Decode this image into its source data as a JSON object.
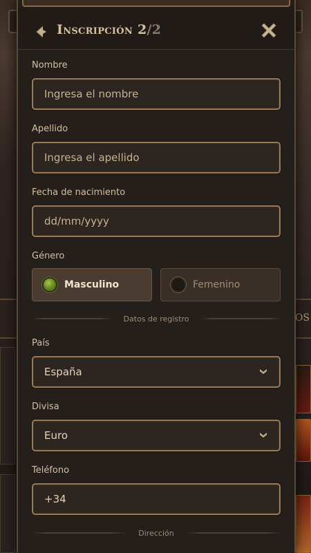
{
  "header": {
    "title": "Inscripción 2",
    "title_total": "/2"
  },
  "form": {
    "first_name": {
      "label": "Nombre",
      "placeholder": "Ingresa el nombre"
    },
    "last_name": {
      "label": "Apellido",
      "placeholder": "Ingresa el apellido"
    },
    "birth_date": {
      "label": "Fecha de nacimiento",
      "placeholder": "dd/mm/yyyy"
    },
    "gender": {
      "label": "Género",
      "options": [
        {
          "label": "Masculino",
          "selected": true
        },
        {
          "label": "Femenino",
          "selected": false
        }
      ]
    },
    "section_registration": "Datos de registro",
    "country": {
      "label": "País",
      "value": "España"
    },
    "currency": {
      "label": "Divisa",
      "value": "Euro"
    },
    "phone": {
      "label": "Teléfono",
      "value": "+34"
    },
    "section_address": "Dirección"
  },
  "background": {
    "right_text": "OS"
  },
  "colors": {
    "accent_border": "#9a7a52",
    "radio_selected": "#6d8f22"
  },
  "icons": {
    "back": "back-arrow-icon",
    "close": "close-icon",
    "chevron": "chevron-down-icon"
  }
}
